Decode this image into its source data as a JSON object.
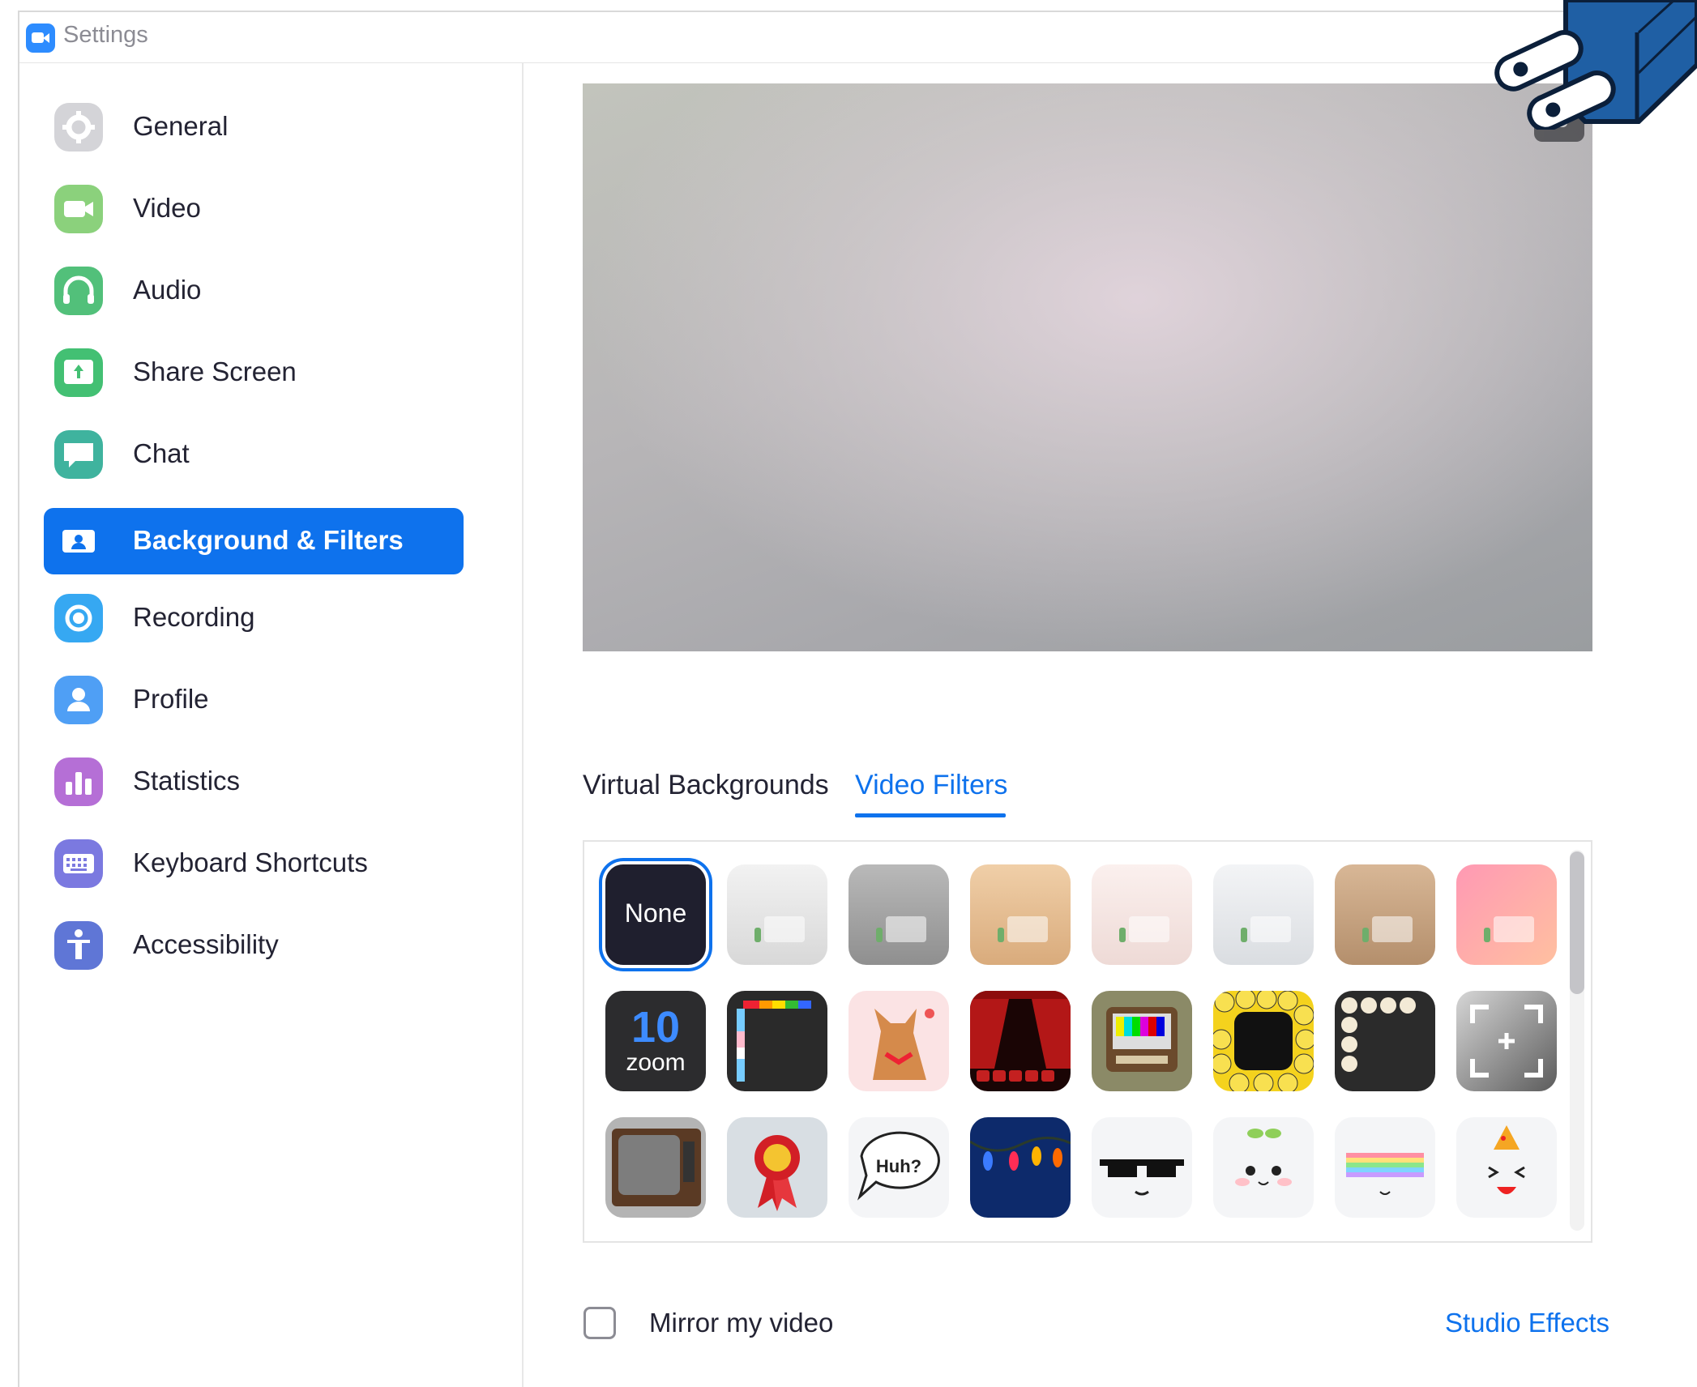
{
  "window": {
    "title": "Settings"
  },
  "sidebar": {
    "items": [
      {
        "label": "General",
        "icon": "gear-icon",
        "color": "#d0d0d4",
        "active": false
      },
      {
        "label": "Video",
        "icon": "video-camera-icon",
        "color": "#8bd17c",
        "active": false
      },
      {
        "label": "Audio",
        "icon": "headphones-icon",
        "color": "#52c07a",
        "active": false
      },
      {
        "label": "Share Screen",
        "icon": "share-screen-icon",
        "color": "#43c073",
        "active": false
      },
      {
        "label": "Chat",
        "icon": "chat-bubble-icon",
        "color": "#3fb39e",
        "active": false
      },
      {
        "label": "Background & Filters",
        "icon": "background-icon",
        "color": "#0e72ed",
        "active": true
      },
      {
        "label": "Recording",
        "icon": "record-icon",
        "color": "#36a8f2",
        "active": false
      },
      {
        "label": "Profile",
        "icon": "person-icon",
        "color": "#4f9ff5",
        "active": false
      },
      {
        "label": "Statistics",
        "icon": "bar-chart-icon",
        "color": "#b56fd6",
        "active": false
      },
      {
        "label": "Keyboard Shortcuts",
        "icon": "keyboard-icon",
        "color": "#7b79e0",
        "active": false
      },
      {
        "label": "Accessibility",
        "icon": "accessibility-icon",
        "color": "#5f76d6",
        "active": false
      }
    ]
  },
  "tabs": {
    "virtual_backgrounds": "Virtual Backgrounds",
    "video_filters": "Video Filters",
    "active": "Video Filters"
  },
  "filters": {
    "none_label": "None",
    "bubble_text": "Huh?",
    "zoom_tile_number": "10",
    "zoom_tile_word": "zoom"
  },
  "mirror": {
    "label": "Mirror my video",
    "checked": false
  },
  "studio_effects": {
    "label": "Studio Effects"
  },
  "colors": {
    "accent": "#0e72ed",
    "text": "#232333"
  }
}
